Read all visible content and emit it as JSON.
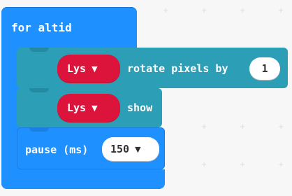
{
  "forever_block": {
    "label": "for altid"
  },
  "blocks": [
    {
      "strip_label": "Lys",
      "action_text": "rotate pixels by",
      "value": "1"
    },
    {
      "strip_label": "Lys",
      "action_text": "show"
    }
  ],
  "pause_block": {
    "label": "pause (ms)",
    "value": "150"
  },
  "icons": {
    "dropdown": "caret-down-icon",
    "grid": "plus-grid-marker"
  },
  "colors": {
    "forever_blue": "#1e90ff",
    "neopixel_teal": "#2c9fb7",
    "strip_red": "#dc143c",
    "value_white": "#ffffff"
  }
}
